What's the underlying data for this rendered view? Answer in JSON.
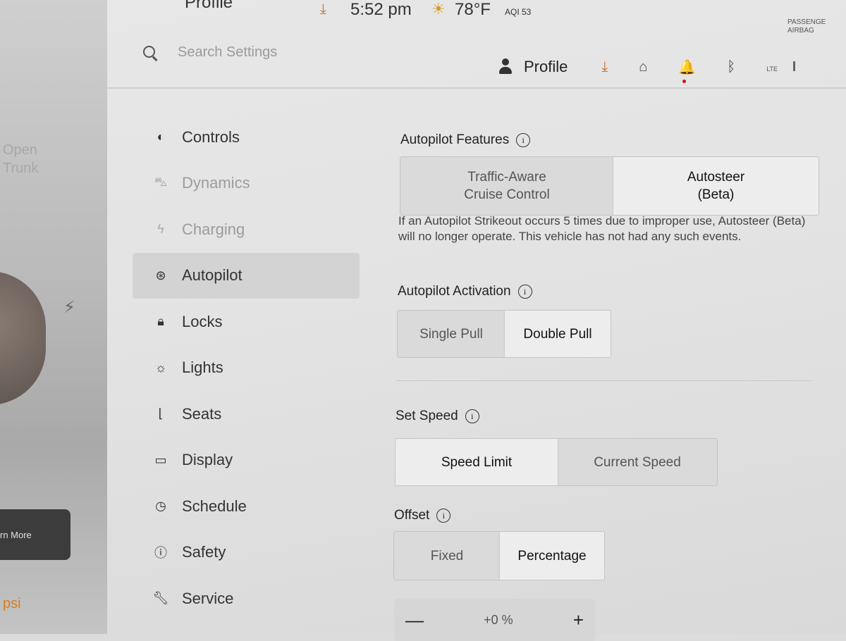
{
  "left_panel": {
    "trunk_line1": "Open",
    "trunk_line2": "Trunk",
    "learn_more": "rn More",
    "psi": "psi"
  },
  "status_bar": {
    "profile": "Profile",
    "time": "5:52 pm",
    "temperature": "78°F",
    "aqi": "AQI 53",
    "airbag_line1": "PASSENGE",
    "airbag_line2": "AIRBAG"
  },
  "search": {
    "placeholder": "Search Settings"
  },
  "top_bar": {
    "profile_label": "Profile",
    "lte": "LTE"
  },
  "sidebar": {
    "items": [
      {
        "label": "Controls",
        "icon": "toggle-icon",
        "state": "normal"
      },
      {
        "label": "Dynamics",
        "icon": "car-icon",
        "state": "dim"
      },
      {
        "label": "Charging",
        "icon": "bolt-icon",
        "state": "dim"
      },
      {
        "label": "Autopilot",
        "icon": "steering-wheel-icon",
        "state": "active"
      },
      {
        "label": "Locks",
        "icon": "lock-icon",
        "state": "normal"
      },
      {
        "label": "Lights",
        "icon": "sun-icon",
        "state": "normal"
      },
      {
        "label": "Seats",
        "icon": "seat-icon",
        "state": "normal"
      },
      {
        "label": "Display",
        "icon": "display-icon",
        "state": "normal"
      },
      {
        "label": "Schedule",
        "icon": "clock-icon",
        "state": "normal"
      },
      {
        "label": "Safety",
        "icon": "alert-icon",
        "state": "normal"
      },
      {
        "label": "Service",
        "icon": "wrench-icon",
        "state": "normal"
      }
    ]
  },
  "autopilot": {
    "features_title": "Autopilot Features",
    "features_options": [
      "Traffic-Aware\nCruise Control",
      "Autosteer\n(Beta)"
    ],
    "features_selected": "Autosteer\n(Beta)",
    "strikeout_note": "If an Autopilot Strikeout occurs 5 times due to improper use, Autosteer (Beta) will no longer operate. This vehicle has not had any such events.",
    "activation_title": "Autopilot Activation",
    "activation_options": [
      "Single Pull",
      "Double Pull"
    ],
    "activation_selected": "Double Pull",
    "set_speed_title": "Set Speed",
    "set_speed_options": [
      "Speed Limit",
      "Current Speed"
    ],
    "set_speed_selected": "Speed Limit",
    "offset_title": "Offset",
    "offset_options": [
      "Fixed",
      "Percentage"
    ],
    "offset_selected": "Percentage",
    "offset_minus": "—",
    "offset_value": "+0 %",
    "offset_plus": "+"
  }
}
